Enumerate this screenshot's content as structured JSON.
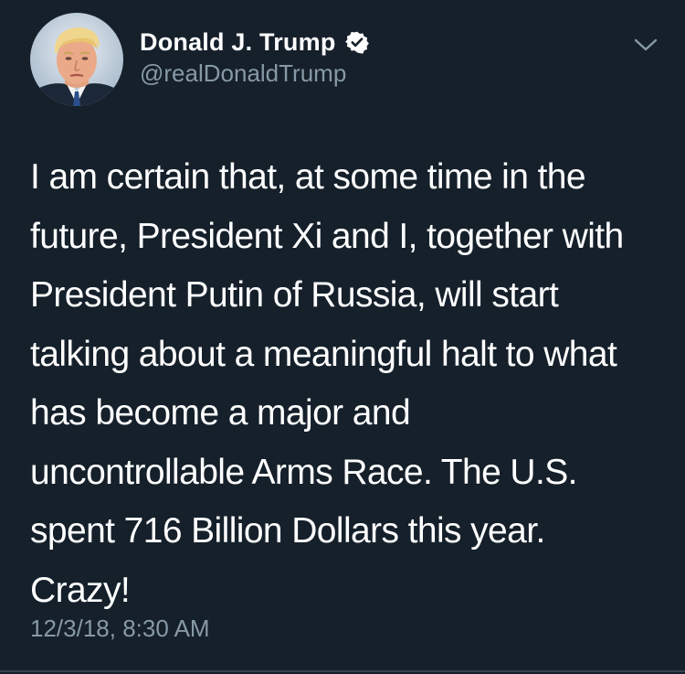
{
  "author": {
    "display_name": "Donald J. Trump",
    "handle": "@realDonaldTrump",
    "verified": true,
    "avatar_icon": "profile-photo"
  },
  "tweet": {
    "text": "I am certain that, at some time in the\nfuture, President Xi and I, together with\nPresident Putin of Russia, will start\ntalking about a meaningful halt to what\nhas become a major and\nuncontrollable Arms Race. The U.S.\nspent 716 Billion Dollars this year.\nCrazy!",
    "timestamp": "12/3/18, 8:30 AM"
  },
  "icons": {
    "menu": "chevron-down-icon",
    "badge": "verified-badge-icon"
  },
  "colors": {
    "background": "#15202b",
    "text_primary": "#ffffff",
    "text_secondary": "#8899a6",
    "divider": "#38444d"
  }
}
